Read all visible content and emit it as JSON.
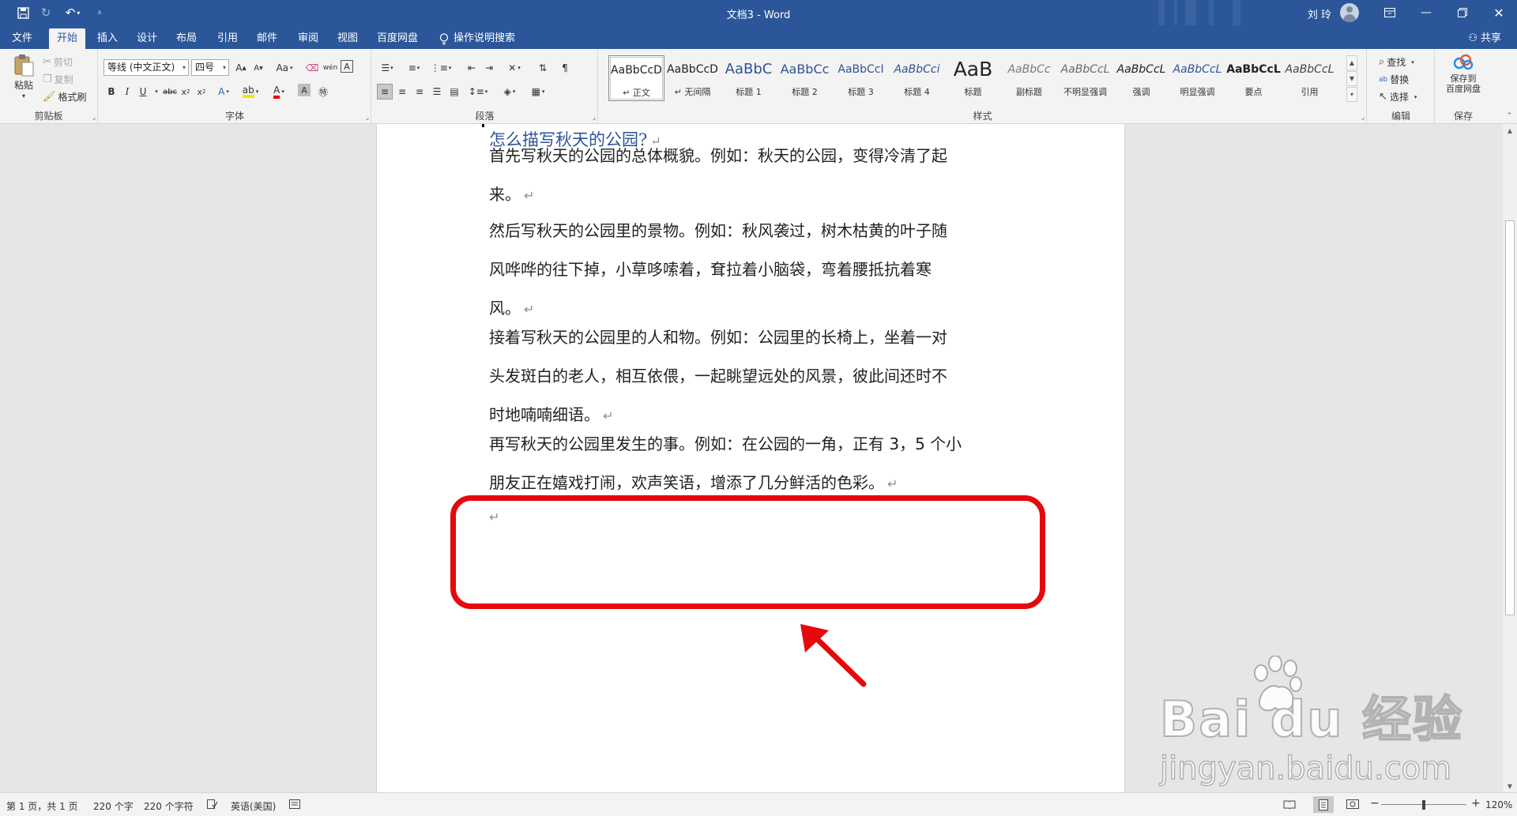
{
  "window": {
    "title": "文档3  -  Word",
    "user": "刘 玲"
  },
  "tabs": [
    {
      "label": "文件"
    },
    {
      "label": "开始"
    },
    {
      "label": "插入"
    },
    {
      "label": "设计"
    },
    {
      "label": "布局"
    },
    {
      "label": "引用"
    },
    {
      "label": "邮件"
    },
    {
      "label": "审阅"
    },
    {
      "label": "视图"
    },
    {
      "label": "百度网盘"
    }
  ],
  "tell_me": "操作说明搜索",
  "share": "共享",
  "clipboard": {
    "paste": "粘贴",
    "cut": "剪切",
    "copy": "复制",
    "format_painter": "格式刷",
    "label": "剪贴板"
  },
  "font": {
    "name": "等线 (中文正文)",
    "size": "四号",
    "label": "字体",
    "aa_label": "Aa"
  },
  "paragraph": {
    "label": "段落"
  },
  "styles": {
    "label": "样式",
    "items": [
      {
        "sample": "AaBbCcD",
        "name": "↵ 正文"
      },
      {
        "sample": "AaBbCcD",
        "name": "↵ 无间隔"
      },
      {
        "sample": "AaBbC",
        "name": "标题 1"
      },
      {
        "sample": "AaBbCc",
        "name": "标题 2"
      },
      {
        "sample": "AaBbCcI",
        "name": "标题 3"
      },
      {
        "sample": "AaBbCci",
        "name": "标题 4"
      },
      {
        "sample": "AaB",
        "name": "标题"
      },
      {
        "sample": "AaBbCc",
        "name": "副标题"
      },
      {
        "sample": "AaBbCcL",
        "name": "不明显强调"
      },
      {
        "sample": "AaBbCcL",
        "name": "强调"
      },
      {
        "sample": "AaBbCcL",
        "name": "明显强调"
      },
      {
        "sample": "AaBbCcL",
        "name": "要点"
      },
      {
        "sample": "AaBbCcL",
        "name": "引用"
      }
    ]
  },
  "editing": {
    "find": "查找",
    "replace": "替换",
    "select": "选择",
    "label": "编辑"
  },
  "save_group": {
    "button_line1": "保存到",
    "button_line2": "百度网盘",
    "label": "保存"
  },
  "document": {
    "heading": "怎么描写秋天的公园?",
    "paragraphs": [
      {
        "lines": [
          "首先写秋天的公园的总体概貌。例如：秋天的公园，变得冷清了起",
          "来。"
        ]
      },
      {
        "lines": [
          "然后写秋天的公园里的景物。例如：秋风袭过，树木枯黄的叶子随",
          "风哗哗的往下掉，小草哆嗦着，耷拉着小脑袋，弯着腰抵抗着寒",
          "风。"
        ]
      },
      {
        "lines": [
          "接着写秋天的公园里的人和物。例如：公园里的长椅上，坐着一对",
          "头发斑白的老人，相互依偎，一起眺望远处的风景，彼此间还时不",
          "时地喃喃细语。"
        ]
      },
      {
        "lines": [
          "再写秋天的公园里发生的事。例如：在公园的一角，正有 3，5 个小",
          "朋友正在嬉戏打闹，欢声笑语，增添了几分鲜活的色彩。"
        ]
      }
    ],
    "paragraph_mark": "↵"
  },
  "annotation": {
    "color": "#e5080c"
  },
  "status": {
    "page": "第 1 页，共 1 页",
    "words": "220 个字",
    "chars": "220 个字符",
    "language": "英语(美国)",
    "zoom": "120%",
    "zoom_level_percent": 120
  },
  "watermark": {
    "brand": "Bai du 经验",
    "url": "jingyan.baidu.com"
  },
  "colors": {
    "accent": "#2b579a",
    "heading": "#2f5496"
  }
}
